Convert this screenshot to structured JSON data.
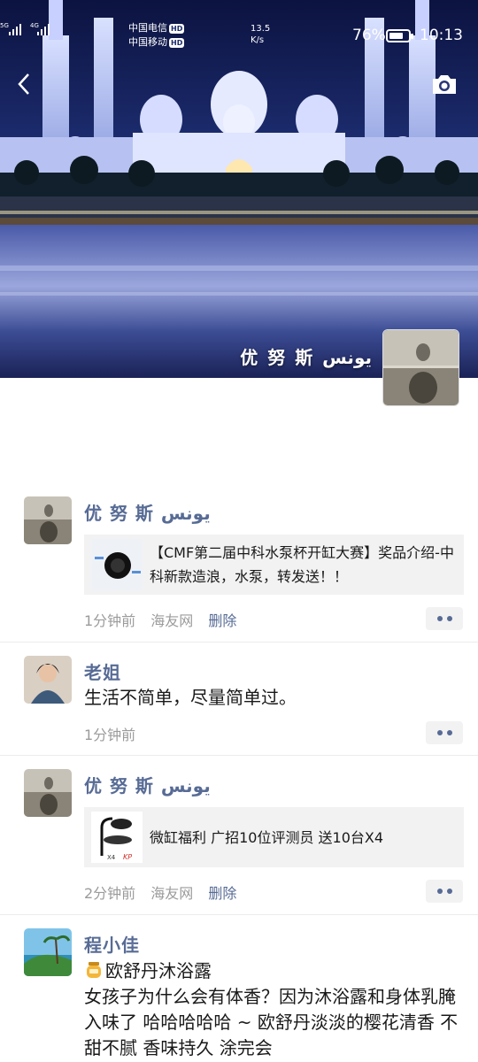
{
  "status_bar": {
    "carrier1": "中国电信",
    "carrier2": "中国移动",
    "hd": "HD",
    "net1": "5G",
    "net2": "4G",
    "speed_value": "13.5",
    "speed_unit": "K/s",
    "battery_percent_text": "76%",
    "battery_level": 0.76,
    "time": "10:13"
  },
  "header": {
    "owner_name": "优 努 斯  يونس",
    "icons": {
      "back": "chevron-left-icon",
      "camera": "camera-icon"
    }
  },
  "posts": [
    {
      "name": "优 努 斯  يونس",
      "link_title": "【CMF第二届中科水泵杯开缸大赛】奖品介绍-中科新款造浪，水泵，转发送！！",
      "time": "1分钟前",
      "source": "海友网",
      "delete": "删除"
    },
    {
      "name": "老姐",
      "text": "生活不简单，尽量简单过。",
      "time": "1分钟前"
    },
    {
      "name": "优 努 斯  يونس",
      "link_title": "微缸福利  广招10位评测员  送10台X4",
      "thumb_caption": "X4",
      "time": "2分钟前",
      "source": "海友网",
      "delete": "删除"
    },
    {
      "name": "程小佳",
      "line1": "欧舒丹沐浴露",
      "text": "女孩子为什么会有体香？因为沐浴露和身体乳腌入味了 哈哈哈哈哈 ~ 欧舒丹淡淡的樱花清香 不甜不腻 香味持久 涂完会"
    }
  ],
  "colors": {
    "name_blue": "#576b95",
    "meta_gray": "#9b9b9b",
    "card_bg": "#f2f2f2"
  }
}
